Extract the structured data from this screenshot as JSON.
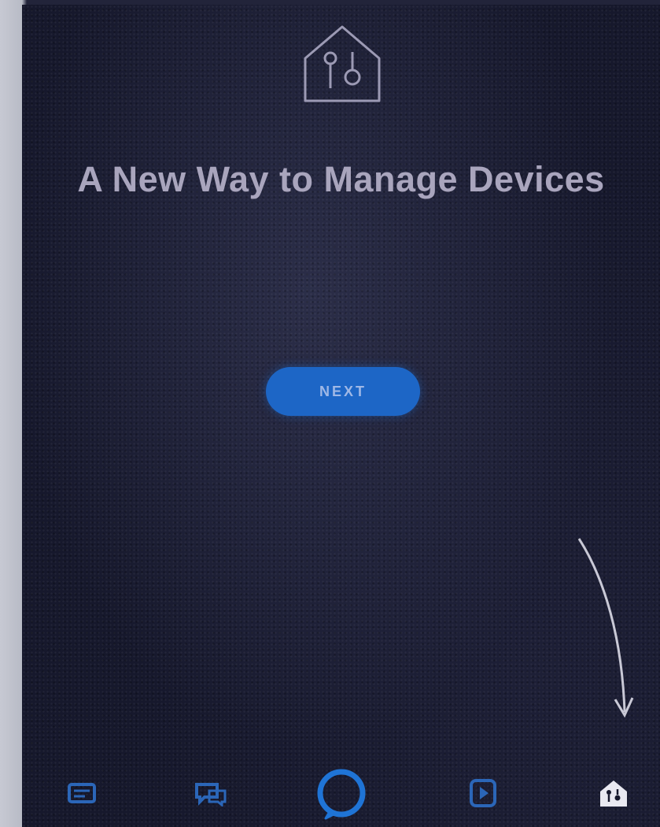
{
  "onboarding": {
    "title": "A New Way to Manage Devices",
    "subtitle": "",
    "next_label": "NEXT"
  },
  "bottom_nav": {
    "items": [
      {
        "name": "home",
        "icon": "home-feed-icon"
      },
      {
        "name": "communicate",
        "icon": "chat-icon"
      },
      {
        "name": "alexa",
        "icon": "alexa-ring-icon"
      },
      {
        "name": "play",
        "icon": "play-icon"
      },
      {
        "name": "devices",
        "icon": "smart-home-icon"
      }
    ]
  },
  "colors": {
    "background": "#16182c",
    "accent": "#1d66c6",
    "nav_icon": "#2b66b8",
    "title": "#a9a5bd"
  }
}
